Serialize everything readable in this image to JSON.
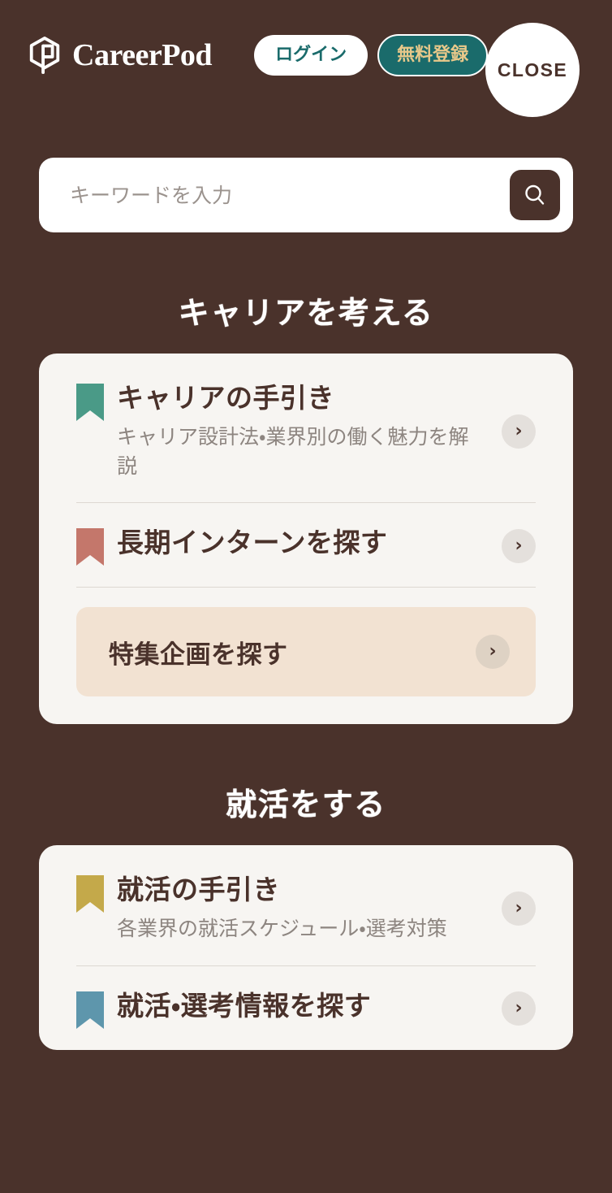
{
  "theme": {
    "background": "#4a322b",
    "card_background": "#f7f5f2",
    "featured_background": "#f2e2d2",
    "accent_teal": "#1a6b6b",
    "accent_gold_text": "#e8c88a",
    "title_text": "#4a322b",
    "description_text": "#8d8580"
  },
  "header": {
    "brand_name": "CareerPod",
    "logo_icon": "hexagon-p-logo-icon",
    "login_label": "ログイン",
    "register_label": "無料登録",
    "close_label": "CLOSE"
  },
  "search": {
    "placeholder": "キーワードを入力",
    "value": "",
    "button_icon": "search-icon"
  },
  "sections": [
    {
      "title": "キャリアを考える",
      "items": [
        {
          "label": "キャリアの手引き",
          "description": "キャリア設計法・業界別の働く魅力を解説",
          "bookmark_color": "#4a9a87",
          "bookmark_icon": "bookmark-icon",
          "chevron_icon": "chevron-right-icon"
        },
        {
          "label": "長期インターンを探す",
          "description": "",
          "bookmark_color": "#c4776b",
          "bookmark_icon": "bookmark-icon",
          "chevron_icon": "chevron-right-icon"
        }
      ],
      "featured": {
        "label": "特集企画を探す",
        "chevron_icon": "chevron-right-icon"
      }
    },
    {
      "title": "就活をする",
      "items": [
        {
          "label": "就活の手引き",
          "description": "各業界の就活スケジュール・選考対策",
          "bookmark_color": "#c4a94a",
          "bookmark_icon": "bookmark-icon",
          "chevron_icon": "chevron-right-icon"
        },
        {
          "label": "就活・選考情報を探す",
          "description": "",
          "bookmark_color": "#5e96ac",
          "bookmark_icon": "bookmark-icon",
          "chevron_icon": "chevron-right-icon"
        }
      ]
    }
  ]
}
